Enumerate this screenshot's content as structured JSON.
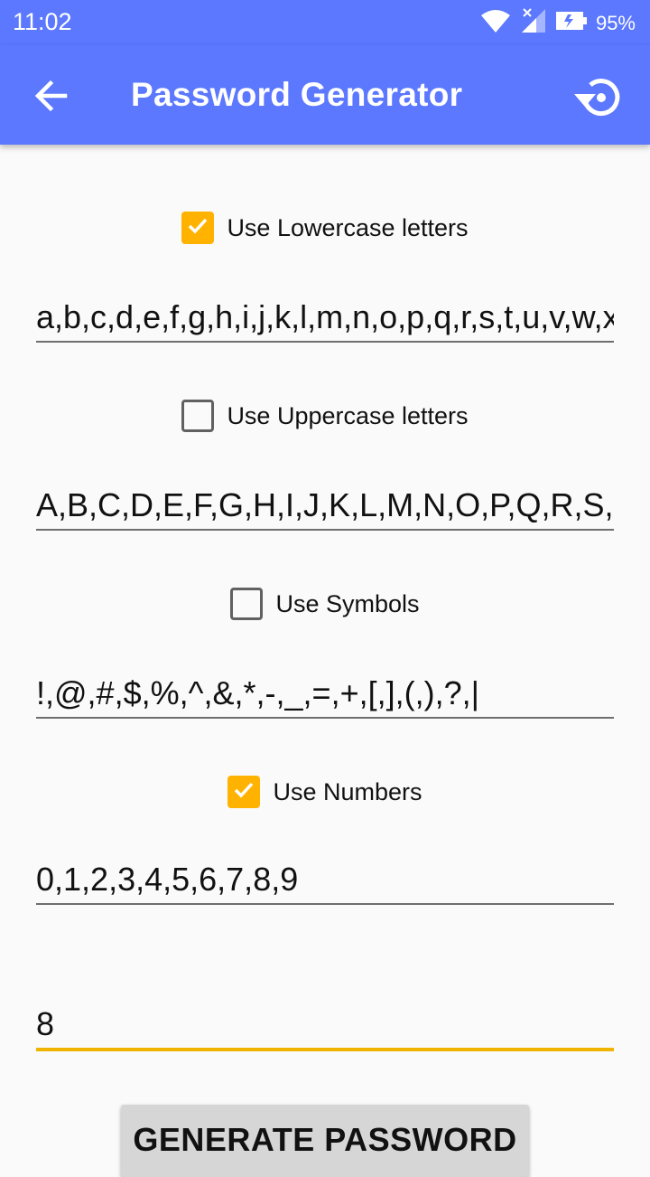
{
  "status_bar": {
    "time": "11:02",
    "battery": "95%"
  },
  "app_bar": {
    "title": "Password Generator",
    "back_icon": "arrow-left-icon",
    "reset_icon": "restore-icon"
  },
  "options": [
    {
      "label": "Use Lowercase letters",
      "checked": true,
      "chars": "a,b,c,d,e,f,g,h,i,j,k,l,m,n,o,p,q,r,s,t,u,v,w,x"
    },
    {
      "label": "Use Uppercase letters",
      "checked": false,
      "chars": "A,B,C,D,E,F,G,H,I,J,K,L,M,N,O,P,Q,R,S,T,"
    },
    {
      "label": "Use Symbols",
      "checked": false,
      "chars": "!,@,#,$,%,^,&,*,-,_,=,+,[,],(,),?,|"
    },
    {
      "label": "Use Numbers",
      "checked": true,
      "chars": "0,1,2,3,4,5,6,7,8,9"
    }
  ],
  "length_field": {
    "value": "8"
  },
  "generate_button": {
    "label": "GENERATE PASSWORD"
  },
  "colors": {
    "primary": "#5b78ff",
    "accent": "#ffb300",
    "background": "#fafafa"
  }
}
